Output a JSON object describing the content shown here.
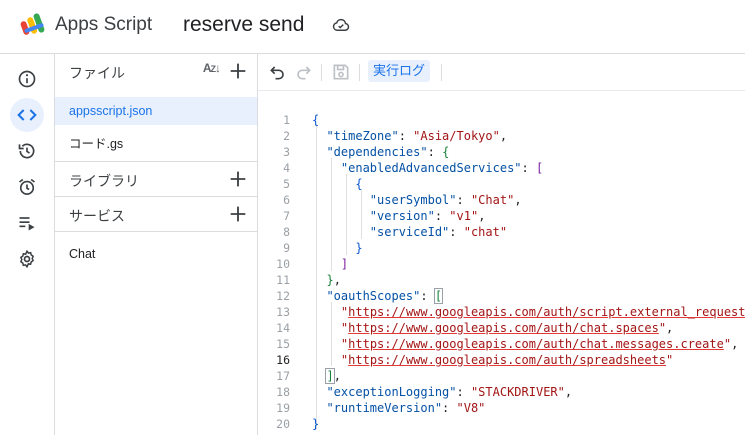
{
  "header": {
    "app_name": "Apps Script",
    "project_title": "reserve send"
  },
  "rail": [
    "info-icon",
    "code-icon",
    "history-icon",
    "alarm-icon",
    "run-list-icon",
    "gear-icon"
  ],
  "files_panel": {
    "files_label": "ファイル",
    "files": [
      {
        "name": "appsscript.json",
        "active": true
      },
      {
        "name": "コード.gs",
        "active": false
      }
    ],
    "libraries_label": "ライブラリ",
    "services_label": "サービス",
    "services": [
      "Chat"
    ]
  },
  "toolbar": {
    "exec_log_label": "実行ログ"
  },
  "editor": {
    "current_line": 16,
    "line_numbers": [
      "1",
      "2",
      "3",
      "4",
      "5",
      "6",
      "7",
      "8",
      "9",
      "10",
      "11",
      "12",
      "13",
      "14",
      "15",
      "16",
      "17",
      "18",
      "19",
      "20"
    ],
    "json": {
      "timeZone_key": "\"timeZone\"",
      "timeZone_val": "\"Asia/Tokyo\"",
      "dependencies_key": "\"dependencies\"",
      "eas_key": "\"enabledAdvancedServices\"",
      "userSymbol_key": "\"userSymbol\"",
      "userSymbol_val": "\"Chat\"",
      "version_key": "\"version\"",
      "version_val": "\"v1\"",
      "serviceId_key": "\"serviceId\"",
      "serviceId_val": "\"chat\"",
      "oauthScopes_key": "\"oauthScopes\"",
      "scope1": "https://www.googleapis.com/auth/script.external_request",
      "scope2": "https://www.googleapis.com/auth/chat.spaces",
      "scope3": "https://www.googleapis.com/auth/chat.messages.create",
      "scope4": "https://www.googleapis.com/auth/spreadsheets",
      "exceptionLogging_key": "\"exceptionLogging\"",
      "exceptionLogging_val": "\"STACKDRIVER\"",
      "runtimeVersion_key": "\"runtimeVersion\"",
      "runtimeVersion_val": "\"V8\""
    }
  }
}
